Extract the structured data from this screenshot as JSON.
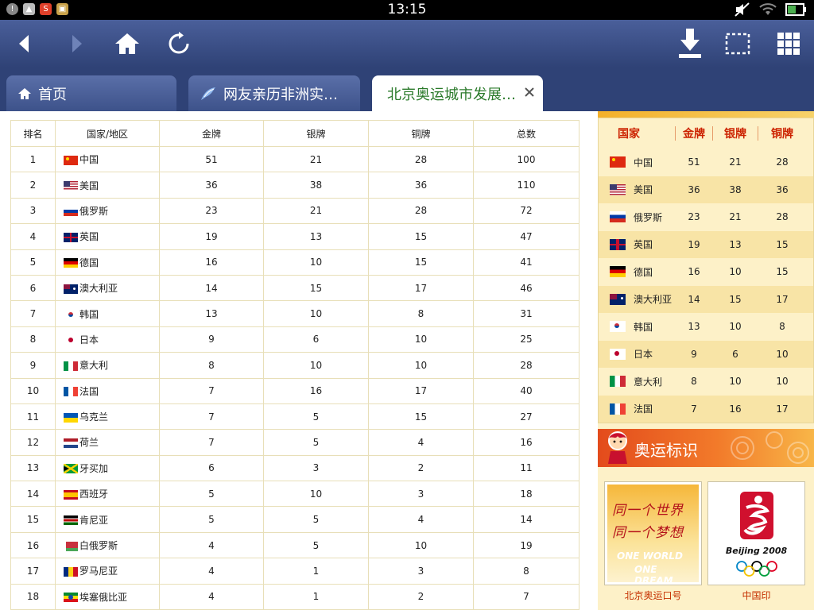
{
  "status": {
    "time": "13:15",
    "left_icons": [
      "alert-icon",
      "image-icon",
      "s-app-icon",
      "shop-icon"
    ],
    "right_icons": [
      "mute-icon",
      "wifi-icon",
      "battery-icon"
    ]
  },
  "toolbar": {
    "icons": [
      "back-icon",
      "forward-icon",
      "home-icon",
      "refresh-icon",
      "download-icon",
      "select-icon",
      "grid-icon"
    ]
  },
  "tabs": [
    {
      "label": "首页",
      "icon": "home-icon"
    },
    {
      "label": "网友亲历非洲实…",
      "icon": "bird-icon"
    },
    {
      "label": "北京奥运城市发展…",
      "icon": ""
    }
  ],
  "table": {
    "headers": [
      "排名",
      "国家/地区",
      "金牌",
      "银牌",
      "铜牌",
      "总数"
    ],
    "rows": [
      {
        "rank": "1",
        "country": "中国",
        "gold": "51",
        "silver": "21",
        "bronze": "28",
        "total": "100",
        "flag": "cn"
      },
      {
        "rank": "2",
        "country": "美国",
        "gold": "36",
        "silver": "38",
        "bronze": "36",
        "total": "110",
        "flag": "us"
      },
      {
        "rank": "3",
        "country": "俄罗斯",
        "gold": "23",
        "silver": "21",
        "bronze": "28",
        "total": "72",
        "flag": "ru"
      },
      {
        "rank": "4",
        "country": "英国",
        "gold": "19",
        "silver": "13",
        "bronze": "15",
        "total": "47",
        "flag": "gb"
      },
      {
        "rank": "5",
        "country": "德国",
        "gold": "16",
        "silver": "10",
        "bronze": "15",
        "total": "41",
        "flag": "de"
      },
      {
        "rank": "6",
        "country": "澳大利亚",
        "gold": "14",
        "silver": "15",
        "bronze": "17",
        "total": "46",
        "flag": "au"
      },
      {
        "rank": "7",
        "country": "韩国",
        "gold": "13",
        "silver": "10",
        "bronze": "8",
        "total": "31",
        "flag": "kr"
      },
      {
        "rank": "8",
        "country": "日本",
        "gold": "9",
        "silver": "6",
        "bronze": "10",
        "total": "25",
        "flag": "jp"
      },
      {
        "rank": "9",
        "country": "意大利",
        "gold": "8",
        "silver": "10",
        "bronze": "10",
        "total": "28",
        "flag": "it"
      },
      {
        "rank": "10",
        "country": "法国",
        "gold": "7",
        "silver": "16",
        "bronze": "17",
        "total": "40",
        "flag": "fr"
      },
      {
        "rank": "11",
        "country": "乌克兰",
        "gold": "7",
        "silver": "5",
        "bronze": "15",
        "total": "27",
        "flag": "ua"
      },
      {
        "rank": "12",
        "country": "荷兰",
        "gold": "7",
        "silver": "5",
        "bronze": "4",
        "total": "16",
        "flag": "nl"
      },
      {
        "rank": "13",
        "country": "牙买加",
        "gold": "6",
        "silver": "3",
        "bronze": "2",
        "total": "11",
        "flag": "jm"
      },
      {
        "rank": "14",
        "country": "西班牙",
        "gold": "5",
        "silver": "10",
        "bronze": "3",
        "total": "18",
        "flag": "es"
      },
      {
        "rank": "15",
        "country": "肯尼亚",
        "gold": "5",
        "silver": "5",
        "bronze": "4",
        "total": "14",
        "flag": "ke"
      },
      {
        "rank": "16",
        "country": "白俄罗斯",
        "gold": "4",
        "silver": "5",
        "bronze": "10",
        "total": "19",
        "flag": "by"
      },
      {
        "rank": "17",
        "country": "罗马尼亚",
        "gold": "4",
        "silver": "1",
        "bronze": "3",
        "total": "8",
        "flag": "ro"
      },
      {
        "rank": "18",
        "country": "埃塞俄比亚",
        "gold": "4",
        "silver": "1",
        "bronze": "2",
        "total": "7",
        "flag": "et"
      }
    ]
  },
  "sidebar": {
    "medal_headers": [
      "国家",
      "金牌",
      "银牌",
      "铜牌"
    ],
    "medal_rows": [
      {
        "country": "中国",
        "gold": "51",
        "silver": "21",
        "bronze": "28",
        "flag": "cn"
      },
      {
        "country": "美国",
        "gold": "36",
        "silver": "38",
        "bronze": "36",
        "flag": "us"
      },
      {
        "country": "俄罗斯",
        "gold": "23",
        "silver": "21",
        "bronze": "28",
        "flag": "ru"
      },
      {
        "country": "英国",
        "gold": "19",
        "silver": "13",
        "bronze": "15",
        "flag": "gb"
      },
      {
        "country": "德国",
        "gold": "16",
        "silver": "10",
        "bronze": "15",
        "flag": "de"
      },
      {
        "country": "澳大利亚",
        "gold": "14",
        "silver": "15",
        "bronze": "17",
        "flag": "au"
      },
      {
        "country": "韩国",
        "gold": "13",
        "silver": "10",
        "bronze": "8",
        "flag": "kr"
      },
      {
        "country": "日本",
        "gold": "9",
        "silver": "6",
        "bronze": "10",
        "flag": "jp"
      },
      {
        "country": "意大利",
        "gold": "8",
        "silver": "10",
        "bronze": "10",
        "flag": "it"
      },
      {
        "country": "法国",
        "gold": "7",
        "silver": "16",
        "bronze": "17",
        "flag": "fr"
      }
    ],
    "section_title": "奥运标识",
    "slogan": {
      "cn_line1": "同一个世界",
      "cn_line2": "同一个梦想",
      "en_line1": "ONE WORLD",
      "en_line2": "ONE DREAM",
      "caption": "北京奥运口号"
    },
    "emblem": {
      "text": "Beijing 2008",
      "caption": "中国印"
    }
  },
  "colors": {
    "toolbar": "#3b4f88",
    "active_tab_text": "#2a7a2a",
    "sidebar_bg": "#fdf1c8",
    "header_red": "#cc2200",
    "table_border": "#e8dfb8"
  }
}
